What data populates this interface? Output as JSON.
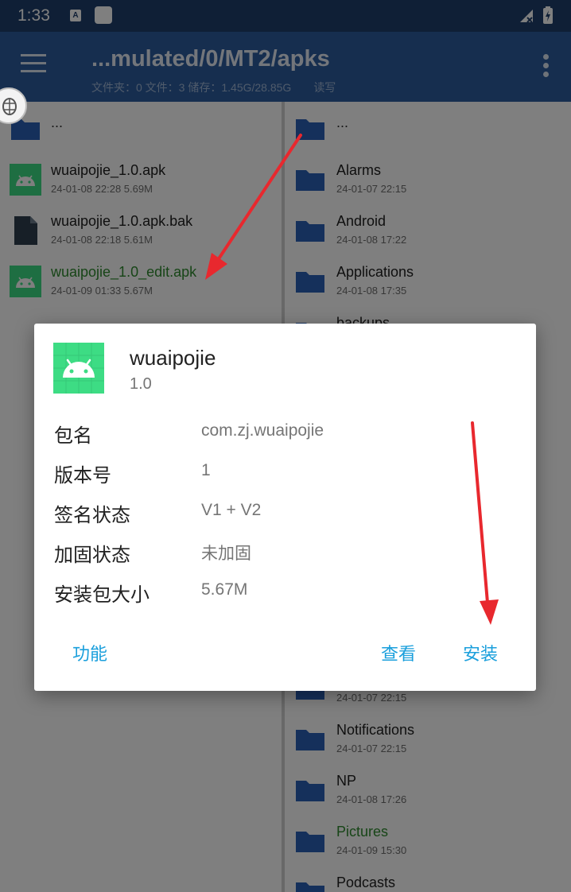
{
  "status_bar": {
    "time": "1:33",
    "notif_icon": "a-icon"
  },
  "app_bar": {
    "title": "...mulated/0/MT2/apks",
    "subtitle": "文件夹：0  文件：3  储存：1.45G/28.85G",
    "permission": "读写"
  },
  "left_pane": {
    "items": [
      {
        "name": "...",
        "meta": "",
        "icon": "folder-icon"
      },
      {
        "name": "wuaipojie_1.0.apk",
        "meta": "24-01-08 22:28  5.69M",
        "icon": "android-apk-icon"
      },
      {
        "name": "wuaipojie_1.0.apk.bak",
        "meta": "24-01-08 22:18  5.61M",
        "icon": "file-icon"
      },
      {
        "name": "wuaipojie_1.0_edit.apk",
        "meta": "24-01-09 01:33  5.67M",
        "icon": "android-apk-icon"
      }
    ]
  },
  "right_pane": {
    "items": [
      {
        "name": "...",
        "meta": ""
      },
      {
        "name": "Alarms",
        "meta": "24-01-07 22:15"
      },
      {
        "name": "Android",
        "meta": "24-01-08 17:22"
      },
      {
        "name": "Applications",
        "meta": "24-01-08 17:35"
      },
      {
        "name": "backups",
        "meta": ""
      },
      {
        "name": "",
        "meta": "24-01-07 22:15"
      },
      {
        "name": "Notifications",
        "meta": "24-01-07 22:15"
      },
      {
        "name": "NP",
        "meta": "24-01-08 17:26"
      },
      {
        "name": "Pictures",
        "meta": "24-01-09 15:30"
      },
      {
        "name": "Podcasts",
        "meta": ""
      }
    ]
  },
  "dialog": {
    "app_name": "wuaipojie",
    "version": "1.0",
    "rows": [
      {
        "label": "包名",
        "value": "com.zj.wuaipojie"
      },
      {
        "label": "版本号",
        "value": "1"
      },
      {
        "label": "签名状态",
        "value": "V1 + V2"
      },
      {
        "label": "加固状态",
        "value": "未加固"
      },
      {
        "label": "安装包大小",
        "value": "5.67M"
      }
    ],
    "buttons": {
      "function": "功能",
      "view": "查看",
      "install": "安装"
    }
  },
  "colors": {
    "status_bar": "#1f3e6c",
    "app_bar": "#2c5c9e",
    "folder": "#2a61b6",
    "apk_green": "#3ddc84",
    "accent_button": "#1a9fdc",
    "highlight_file": "#2e8b2e",
    "arrow": "#e8282e"
  }
}
